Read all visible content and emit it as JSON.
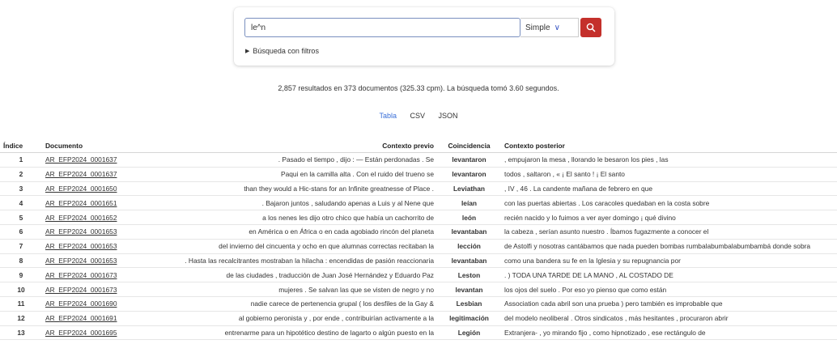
{
  "search": {
    "query": "le^n",
    "mode": "Simple",
    "filters_label": "Búsqueda con filtros"
  },
  "summary": "2,857 resultados en 373 documentos (325.33 cpm). La búsqueda tomó 3.60 segundos.",
  "formats": [
    "Tabla",
    "CSV",
    "JSON"
  ],
  "table": {
    "headers": [
      "Índice",
      "Documento",
      "Contexto previo",
      "Coincidencia",
      "Contexto posterior"
    ],
    "rows": [
      {
        "idx": "1",
        "doc": "AR_EFP2024_0001637",
        "prev": ". Pasado el tiempo , dijo : — Están perdonadas . Se",
        "match": "levantaron",
        "post": ", empujaron la mesa , llorando le besaron los pies , las"
      },
      {
        "idx": "2",
        "doc": "AR_EFP2024_0001637",
        "prev": "Paqui en la camilla alta . Con el ruido del trueno se",
        "match": "levantaron",
        "post": "todos , saltaron , « ¡ El santo ! ¡ El santo"
      },
      {
        "idx": "3",
        "doc": "AR_EFP2024_0001650",
        "prev": "than they would a Hic-stans for an Infinite greatnesse of Place .",
        "match": "Leviathan",
        "post": ", IV , 46 . La candente mañana de febrero en que"
      },
      {
        "idx": "4",
        "doc": "AR_EFP2024_0001651",
        "prev": ". Bajaron juntos , saludando apenas a Luis y al Nene que",
        "match": "leían",
        "post": "con las puertas abiertas . Los caracoles quedaban en la costa sobre"
      },
      {
        "idx": "5",
        "doc": "AR_EFP2024_0001652",
        "prev": "a los nenes les dijo otro chico que había un cachorrito de",
        "match": "león",
        "post": "recién nacido y lo fuimos a ver ayer domingo ¡ qué divino"
      },
      {
        "idx": "6",
        "doc": "AR_EFP2024_0001653",
        "prev": "en América o en África o en cada agobiado rincón del planeta",
        "match": "levantaban",
        "post": "la cabeza , serían asunto nuestro . Íbamos fugazmente a conocer el"
      },
      {
        "idx": "7",
        "doc": "AR_EFP2024_0001653",
        "prev": "del invierno del cincuenta y ocho en que alumnas correctas recitaban la",
        "match": "lección",
        "post": "de Astolfi y nosotras cantábamos que nada pueden bombas rumbalabumbalabumbambá donde sobra"
      },
      {
        "idx": "8",
        "doc": "AR_EFP2024_0001653",
        "prev": ". Hasta las recalcitrantes mostraban la hilacha : encendidas de pasión reaccionaria",
        "match": "levantaban",
        "post": "como una bandera su fe en la Iglesia y su repugnancia por"
      },
      {
        "idx": "9",
        "doc": "AR_EFP2024_0001673",
        "prev": "de las ciudades , traducción de Juan José Hernández y Eduardo Paz",
        "match": "Leston",
        "post": ". ) TODA UNA TARDE DE LA MANO , AL COSTADO DE"
      },
      {
        "idx": "10",
        "doc": "AR_EFP2024_0001673",
        "prev": "mujeres . Se salvan las que se visten de negro y no",
        "match": "levantan",
        "post": "los ojos del suelo . Por eso yo pienso que como están"
      },
      {
        "idx": "11",
        "doc": "AR_EFP2024_0001690",
        "prev": "nadie carece de pertenencia grupal ( los desfiles de la Gay &",
        "match": "Lesbian",
        "post": "Association cada abril son una prueba ) pero también es improbable que"
      },
      {
        "idx": "12",
        "doc": "AR_EFP2024_0001691",
        "prev": "al gobierno peronista y , por ende , contribuirían activamente a la",
        "match": "legitimación",
        "post": "del modelo neoliberal . Otros sindicatos , más hesitantes , procuraron abrir"
      },
      {
        "idx": "13",
        "doc": "AR_EFP2024_0001695",
        "prev": "entrenarme para un hipotético destino de lagarto o algún puesto en la",
        "match": "Legión",
        "post": "Extranjera- , yo mirando fijo , como hipnotizado , ese rectángulo de"
      }
    ]
  }
}
